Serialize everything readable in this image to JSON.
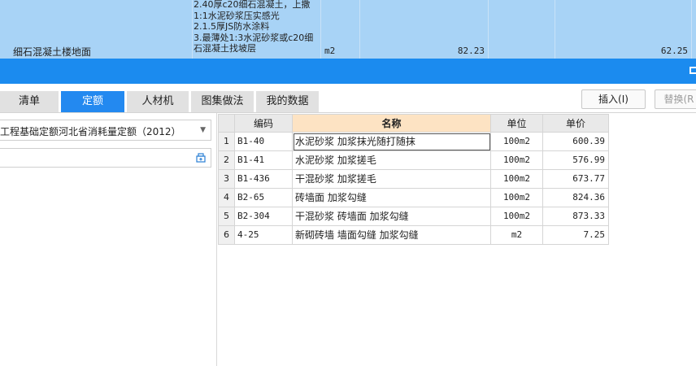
{
  "top_row": {
    "name": "细石混凝土楼地面",
    "description_lines": [
      "2.40厚c20细石混凝土，上撒",
      "1:1水泥砂浆压实感光",
      "2.1.5厚JS防水涂料",
      "3.最薄处1:3水泥砂浆或c20细",
      "石混凝土找坡层"
    ],
    "unit": "m2",
    "quantity": "82.23",
    "price": "62.25"
  },
  "tabs": [
    {
      "label": "清单",
      "active": false
    },
    {
      "label": "定额",
      "active": true
    },
    {
      "label": "人材机",
      "active": false
    },
    {
      "label": "图集做法",
      "active": false
    },
    {
      "label": "我的数据",
      "active": false
    }
  ],
  "buttons": {
    "insert": "插入(I)",
    "replace": "替换(R"
  },
  "left_panel": {
    "quota_library": "工程基础定额河北省消耗量定额（2012）",
    "search_placeholder": ""
  },
  "grid": {
    "headers": {
      "code": "编码",
      "name": "名称",
      "unit": "单位",
      "price": "单价"
    },
    "rows": [
      {
        "num": "1",
        "code": "B1-40",
        "name": "水泥砂浆 加浆抹光随打随抹",
        "unit": "100m2",
        "price": "600.39"
      },
      {
        "num": "2",
        "code": "B1-41",
        "name": "水泥砂浆 加浆搓毛",
        "unit": "100m2",
        "price": "576.99"
      },
      {
        "num": "3",
        "code": "B1-436",
        "name": "干混砂浆 加浆搓毛",
        "unit": "100m2",
        "price": "673.77"
      },
      {
        "num": "4",
        "code": "B2-65",
        "name": "砖墙面 加浆勾缝",
        "unit": "100m2",
        "price": "824.36"
      },
      {
        "num": "5",
        "code": "B2-304",
        "name": "干混砂浆 砖墙面 加浆勾缝",
        "unit": "100m2",
        "price": "873.33"
      },
      {
        "num": "6",
        "code": "4-25",
        "name": "新砌砖墙 墙面勾缝 加浆勾缝",
        "unit": "m2",
        "price": "7.25"
      }
    ]
  },
  "colors": {
    "selected_row": "#a8d3f6",
    "accent_blue": "#1b8bef",
    "name_header": "#fde3c3"
  }
}
